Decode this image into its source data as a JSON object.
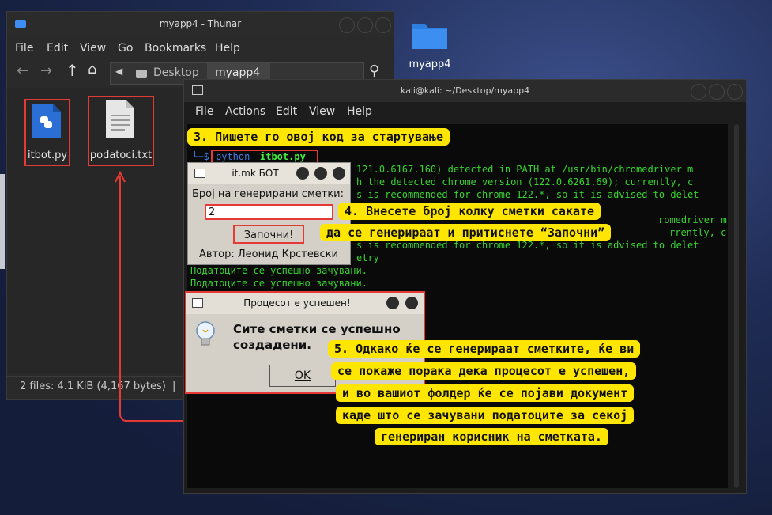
{
  "desktop": {
    "folder_icon_label": "myapp4"
  },
  "thunar": {
    "title": "myapp4 - Thunar",
    "menu": [
      "File",
      "Edit",
      "View",
      "Go",
      "Bookmarks",
      "Help"
    ],
    "path": [
      "Desktop",
      "myapp4"
    ],
    "files": [
      {
        "name": "itbot.py",
        "icon": "python-file-icon"
      },
      {
        "name": "podatoci.txt",
        "icon": "text-file-icon"
      }
    ],
    "status": "2 files: 4.1 KiB (4,167 bytes)  |  Fre"
  },
  "terminal": {
    "title": "kali@kali: ~/Desktop/myapp4",
    "menu": [
      "File",
      "Actions",
      "Edit",
      "View",
      "Help"
    ],
    "prompt_prefix": "└─$",
    "command_cmd": "python",
    "command_arg": "itbot.py",
    "lines": [
      "121.0.6167.160) detected in PATH at /usr/bin/chromedriver m",
      "h the detected chrome version (122.0.6261.69); currently, c",
      "s is recommended for chrome 122.*, so it is advised to delet",
      "",
      "romedriver m",
      "rrently, c",
      "s is recommended for chrome 122.*, so it is advised to delet",
      "etry",
      "Податоците се успешно зачувани.",
      "Податоците се успешно зачувани."
    ]
  },
  "bot_dialog": {
    "title": "it.mk БОТ",
    "label": "Број на генерирани сметки:",
    "input_value": "2",
    "start_button": "Започни!",
    "author": "Автор: Леонид Крстевски"
  },
  "success_dialog": {
    "title": "Процесот е успешен!",
    "message_line1": "Сите сметки се успешно",
    "message_line2": "создадени.",
    "ok_button": "OK"
  },
  "callouts": {
    "step3": "3. Пишете го овој код за стартување",
    "step4_line1": "4. Внесете број колку сметки сакате",
    "step4_line2": "да се генерираат и притиснете “Започни”",
    "step5_lines": [
      "5. Одкако ќе се генерираат сметките, ќе ви",
      "се покаже порака дека процесот е успешен,",
      "и во вашиот фолдер ќе се појави документ",
      "каде што се зачувани податоците за секој",
      "генериран корисник на сметката."
    ]
  },
  "colors": {
    "highlight": "#e53935",
    "callout_bg": "#ffe600",
    "terminal_green": "#38d430"
  }
}
